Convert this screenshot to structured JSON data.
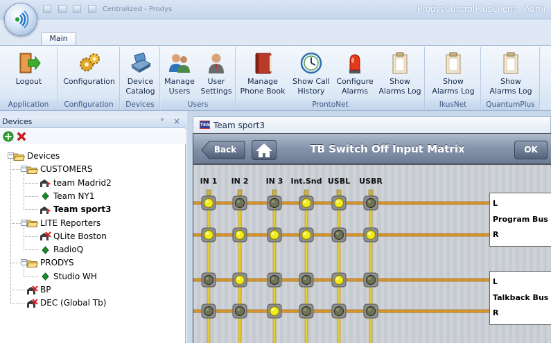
{
  "window": {
    "app_title": "ProdysControlPlusClient - Admi",
    "qat_text": "Centralized - Prodys"
  },
  "ribbon": {
    "tabs": [
      {
        "label": "Main",
        "active": true
      }
    ],
    "groups": [
      {
        "id": "application",
        "label": "Application",
        "buttons": [
          {
            "id": "logout",
            "lines": [
              "Logout"
            ],
            "icon": "exit-door-icon"
          }
        ]
      },
      {
        "id": "configuration",
        "label": "Configuration",
        "buttons": [
          {
            "id": "configuration",
            "lines": [
              "Configuration"
            ],
            "icon": "gears-icon"
          }
        ]
      },
      {
        "id": "devices",
        "label": "Devices",
        "buttons": [
          {
            "id": "device-catalog",
            "lines": [
              "Device",
              "Catalog"
            ],
            "icon": "device-catalog-icon"
          }
        ]
      },
      {
        "id": "users",
        "label": "Users",
        "buttons": [
          {
            "id": "manage-users",
            "lines": [
              "Manage",
              "Users"
            ],
            "icon": "users-icon"
          },
          {
            "id": "user-settings",
            "lines": [
              "User",
              "Settings"
            ],
            "icon": "user-icon"
          }
        ]
      },
      {
        "id": "prontonet",
        "label": "ProntoNet",
        "buttons": [
          {
            "id": "manage-phone-book",
            "lines": [
              "Manage",
              "Phone Book"
            ],
            "icon": "phone-book-icon"
          },
          {
            "id": "show-call-history",
            "lines": [
              "Show Call",
              "History"
            ],
            "icon": "clock-icon"
          },
          {
            "id": "configure-alarms",
            "lines": [
              "Configure",
              "Alarms"
            ],
            "icon": "alarm-light-icon"
          },
          {
            "id": "show-alarms-log-prontonet",
            "lines": [
              "Show",
              "Alarms Log"
            ],
            "icon": "clipboard-icon"
          }
        ]
      },
      {
        "id": "ikusnet",
        "label": "IkusNet",
        "buttons": [
          {
            "id": "show-alarms-log-ikusnet",
            "lines": [
              "Show",
              "Alarms Log"
            ],
            "icon": "clipboard-icon"
          }
        ]
      },
      {
        "id": "quantumplus",
        "label": "QuantumPlus",
        "buttons": [
          {
            "id": "show-alarms-log-quantumplus",
            "lines": [
              "Show",
              "Alarms Log"
            ],
            "icon": "clipboard-icon"
          }
        ]
      }
    ]
  },
  "devices_pane": {
    "title": "Devices",
    "pin_glyph": "ᵠ",
    "close_glyph": "×",
    "tree": [
      {
        "id": "devices-root",
        "label": "Devices",
        "icon": "folder-open-icon",
        "depth": 0,
        "expander": "−"
      },
      {
        "id": "customers",
        "label": "CUSTOMERS",
        "icon": "folder-open-icon",
        "depth": 1,
        "expander": "−"
      },
      {
        "id": "team-madrid2",
        "label": "team Madrid2",
        "icon": "device-connected-icon",
        "depth": 2,
        "bold": false
      },
      {
        "id": "team-ny1",
        "label": "Team NY1",
        "icon": "green-diamond-icon",
        "depth": 2,
        "bold": false
      },
      {
        "id": "team-sport3",
        "label": "Team sport3",
        "icon": "device-connected-icon",
        "depth": 2,
        "bold": true
      },
      {
        "id": "lite-reporters",
        "label": "LITE Reporters",
        "icon": "folder-open-icon",
        "depth": 1,
        "expander": "−"
      },
      {
        "id": "qlite-boston",
        "label": "QLite Boston",
        "icon": "device-disconnected-icon",
        "depth": 2,
        "bold": false
      },
      {
        "id": "radioq",
        "label": "RadioQ",
        "icon": "green-diamond-icon",
        "depth": 2,
        "bold": false
      },
      {
        "id": "prodys",
        "label": "PRODYS",
        "icon": "folder-open-icon",
        "depth": 1,
        "expander": "−"
      },
      {
        "id": "studio-wh",
        "label": "Studio WH",
        "icon": "green-diamond-icon",
        "depth": 2,
        "bold": false
      },
      {
        "id": "bp",
        "label": "BP",
        "icon": "device-disconnected-icon",
        "depth": 1,
        "bold": false
      },
      {
        "id": "dec-global-tb",
        "label": "DEC (Global Tb)",
        "icon": "device-disconnected-icon",
        "depth": 1,
        "bold": false
      }
    ]
  },
  "document": {
    "tab_title": "Team sport3",
    "tab_icon_text": "TEAM",
    "back_label": "Back",
    "title": "TB Switch Off Input Matrix",
    "ok_label": "OK",
    "inputs": [
      "IN 1",
      "IN 2",
      "IN 3",
      "Int.Snd",
      "USBL",
      "USBR"
    ],
    "buses": [
      {
        "name": "Program Bus",
        "channels": [
          "L",
          "R"
        ]
      },
      {
        "name": "Talkback Bus",
        "channels": [
          "L",
          "R"
        ]
      }
    ],
    "rows": [
      {
        "bus": "Program Bus",
        "channel": "L",
        "states": [
          true,
          false,
          false,
          true,
          true,
          false
        ]
      },
      {
        "bus": "Program Bus",
        "channel": "R",
        "states": [
          true,
          true,
          true,
          true,
          false,
          true
        ]
      },
      {
        "bus": "Talkback Bus",
        "channel": "L",
        "states": [
          false,
          true,
          false,
          false,
          true,
          false
        ]
      },
      {
        "bus": "Talkback Bus",
        "channel": "R",
        "states": [
          false,
          false,
          true,
          false,
          false,
          false
        ]
      }
    ],
    "colors": {
      "on": "#f2ea1a",
      "off": "#6e7355",
      "horizontal_line": "#d9962b",
      "vertical_line": "#e5cc2f"
    }
  }
}
